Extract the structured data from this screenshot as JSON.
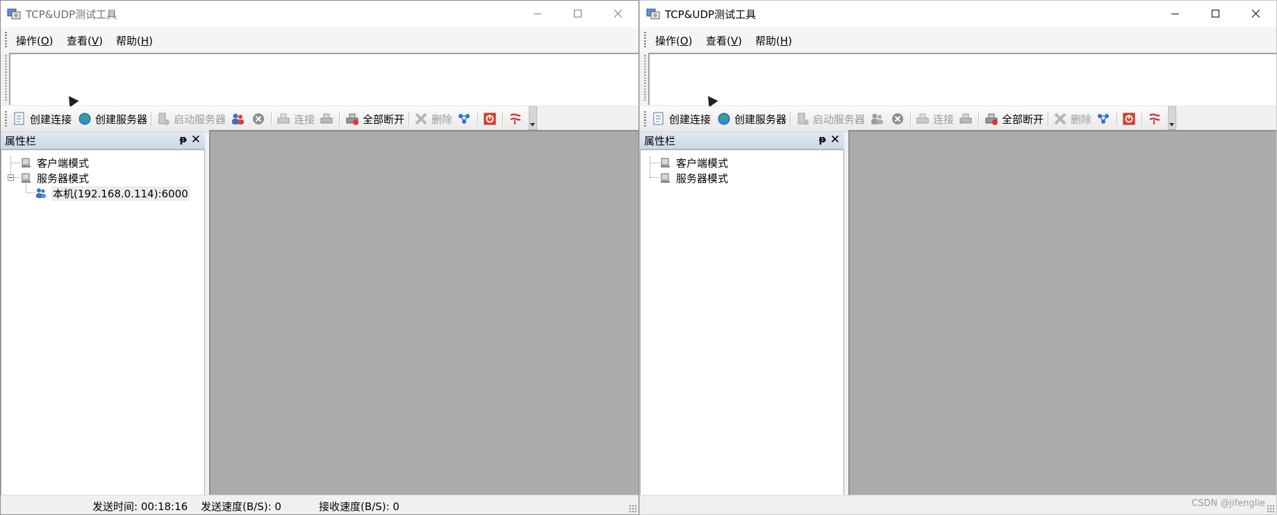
{
  "windows": {
    "left": {
      "title": "TCP&UDP测试工具",
      "menu": [
        {
          "label": "操作(",
          "key": "O",
          "suffix": ")"
        },
        {
          "label": "查看(",
          "key": "V",
          "suffix": ")"
        },
        {
          "label": "帮助(",
          "key": "H",
          "suffix": ")"
        }
      ],
      "toolbar": {
        "create_connection": "创建连接",
        "create_server": "创建服务器",
        "start_server": "启动服务器",
        "connect": "连接",
        "disconnect_all": "全部断开",
        "delete": "删除"
      },
      "panel": {
        "title": "属性栏",
        "pin": "ᵽ",
        "close": "✕"
      },
      "tree": {
        "client_mode": "客户端模式",
        "server_mode": "服务器模式",
        "server_child": "本机(192.168.0.114):6000"
      },
      "status": {
        "send_time": "发送时间: 00:18:16",
        "send_speed": "发送速度(B/S): 0",
        "recv_speed": "接收速度(B/S): 0"
      }
    },
    "right": {
      "title": "TCP&UDP测试工具",
      "menu": [
        {
          "label": "操作(",
          "key": "O",
          "suffix": ")"
        },
        {
          "label": "查看(",
          "key": "V",
          "suffix": ")"
        },
        {
          "label": "帮助(",
          "key": "H",
          "suffix": ")"
        }
      ],
      "toolbar": {
        "create_connection": "创建连接",
        "create_server": "创建服务器",
        "start_server": "启动服务器",
        "connect": "连接",
        "disconnect_all": "全部断开",
        "delete": "删除"
      },
      "panel": {
        "title": "属性栏",
        "pin": "ᵽ",
        "close": "✕"
      },
      "tree": {
        "client_mode": "客户端模式",
        "server_mode": "服务器模式"
      },
      "watermark": "CSDN @jifenglie"
    }
  },
  "icons": {
    "app": "network-app-icon",
    "create_connection": "document-icon",
    "create_server": "globe-icon",
    "start_server": "server-start-icon",
    "users": "users-icon",
    "stop": "stop-circle-icon",
    "connect": "connect-icon",
    "link": "link-icon",
    "disconnect_all": "disconnect-all-icon",
    "delete": "delete-x-icon",
    "network": "network-icon",
    "power": "power-icon",
    "cable": "cable-icon"
  },
  "colors": {
    "mdi_background": "#ababab",
    "panel_header": "#cbd8e8",
    "window_bg": "#f0f0f0"
  }
}
